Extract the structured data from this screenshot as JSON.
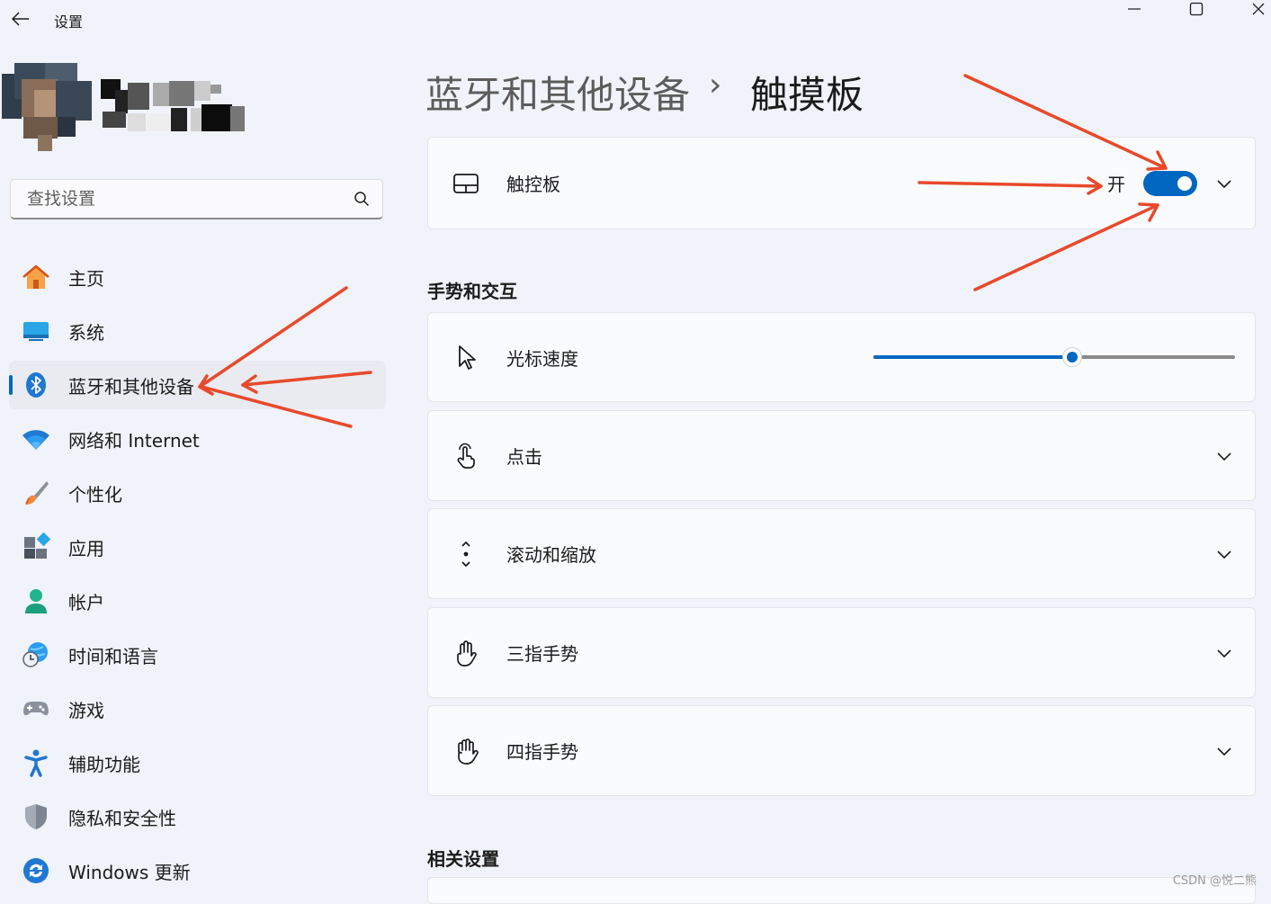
{
  "window": {
    "title": "设置"
  },
  "search": {
    "placeholder": "查找设置"
  },
  "nav": {
    "items": [
      {
        "label": "主页"
      },
      {
        "label": "系统"
      },
      {
        "label": "蓝牙和其他设备"
      },
      {
        "label": "网络和 Internet"
      },
      {
        "label": "个性化"
      },
      {
        "label": "应用"
      },
      {
        "label": "帐户"
      },
      {
        "label": "时间和语言"
      },
      {
        "label": "游戏"
      },
      {
        "label": "辅助功能"
      },
      {
        "label": "隐私和安全性"
      },
      {
        "label": "Windows 更新"
      }
    ],
    "active_index": 2
  },
  "header": {
    "breadcrumb_parent": "蓝牙和其他设备",
    "separator": "›",
    "title": "触摸板"
  },
  "touchpad": {
    "label": "触控板",
    "toggle_state": "开",
    "enabled": true
  },
  "sections": {
    "gestures": "手势和交互",
    "related": "相关设置"
  },
  "settings": {
    "cursor_speed": {
      "label": "光标速度",
      "value_fraction": 0.55
    },
    "tap": {
      "label": "点击"
    },
    "scroll_zoom": {
      "label": "滚动和缩放"
    },
    "three_finger": {
      "label": "三指手势"
    },
    "four_finger": {
      "label": "四指手势"
    }
  },
  "colors": {
    "accent": "#0067c0",
    "annotation_arrow": "#e8492b"
  },
  "watermark": "CSDN @悦二熊"
}
